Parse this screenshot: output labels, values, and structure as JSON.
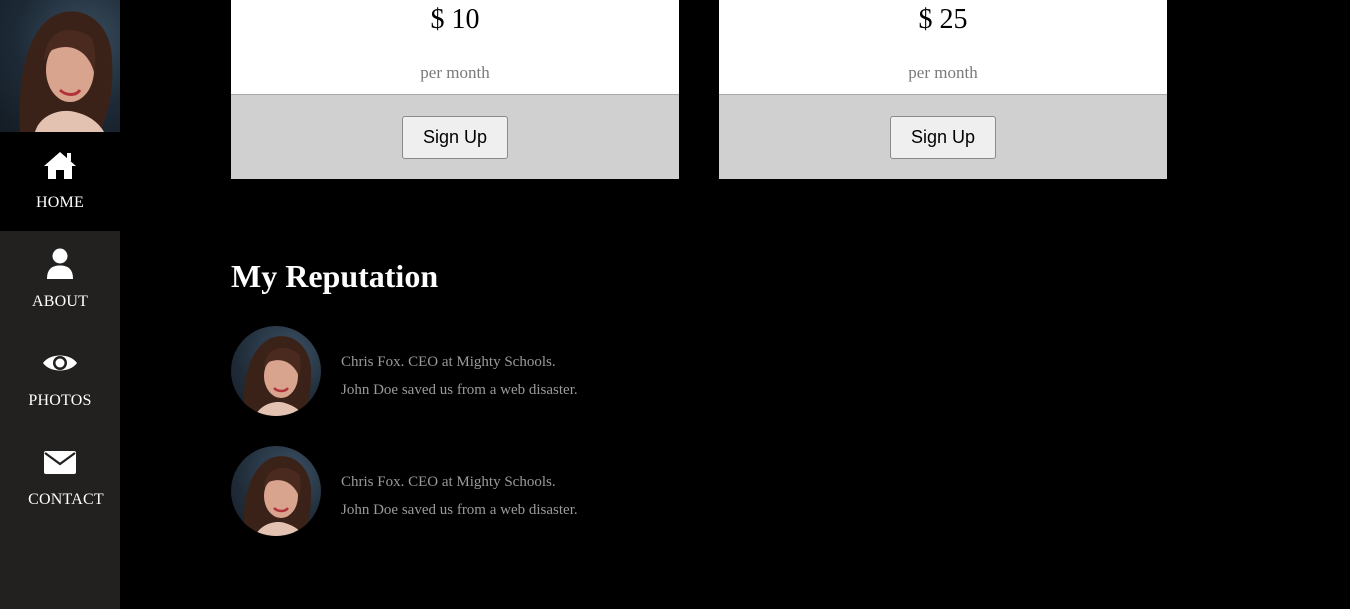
{
  "sidebar": {
    "items": [
      {
        "label": "HOME",
        "icon": "home-icon",
        "active": true
      },
      {
        "label": "ABOUT",
        "icon": "user-icon",
        "active": false
      },
      {
        "label": "PHOTOS",
        "icon": "eye-icon",
        "active": false
      },
      {
        "label": "CONTACT",
        "icon": "envelope-icon",
        "active": false
      }
    ]
  },
  "pricing": {
    "cards": [
      {
        "price": "$ 10",
        "period": "per month",
        "button_label": "Sign Up"
      },
      {
        "price": "$ 25",
        "period": "per month",
        "button_label": "Sign Up"
      }
    ]
  },
  "reputation": {
    "title": "My Reputation",
    "testimonials": [
      {
        "author": "Chris Fox. CEO at Mighty Schools.",
        "quote": "John Doe saved us from a web disaster."
      },
      {
        "author": "Chris Fox. CEO at Mighty Schools.",
        "quote": "John Doe saved us from a web disaster."
      }
    ]
  },
  "colors": {
    "sidebar_bg": "#222120",
    "page_bg": "#000000",
    "card_footer_bg": "#d0d0d0",
    "muted_text": "#9a9a9a"
  }
}
